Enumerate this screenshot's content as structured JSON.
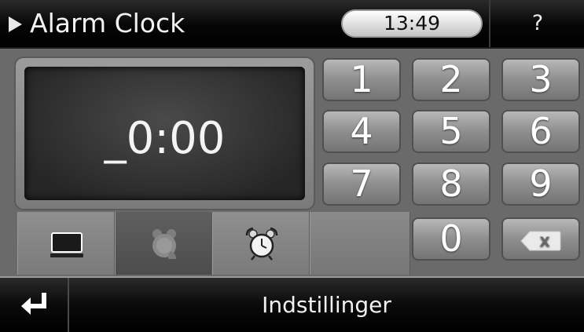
{
  "header": {
    "title": "Alarm Clock",
    "title_icon": "play-arrow-icon",
    "time": "13:49",
    "help_label": "?"
  },
  "display": {
    "value": "_0:00"
  },
  "keypad": {
    "keys": [
      "1",
      "2",
      "3",
      "4",
      "5",
      "6",
      "7",
      "8",
      "9",
      "0"
    ],
    "backspace_icon": "backspace-x-icon",
    "backspace_label": "X"
  },
  "modes": {
    "sleep_icon": "monitor-moon-icon",
    "snooze_icon": "snooze-clock-icon",
    "alarm_icon": "alarm-clock-icon"
  },
  "footer": {
    "back_icon": "return-arrow-icon",
    "label": "Indstillinger"
  },
  "colors": {
    "bar_background": "#000000",
    "key_face": "#8e8e8e",
    "display_background": "#2e2e2e",
    "text": "#ffffff"
  }
}
